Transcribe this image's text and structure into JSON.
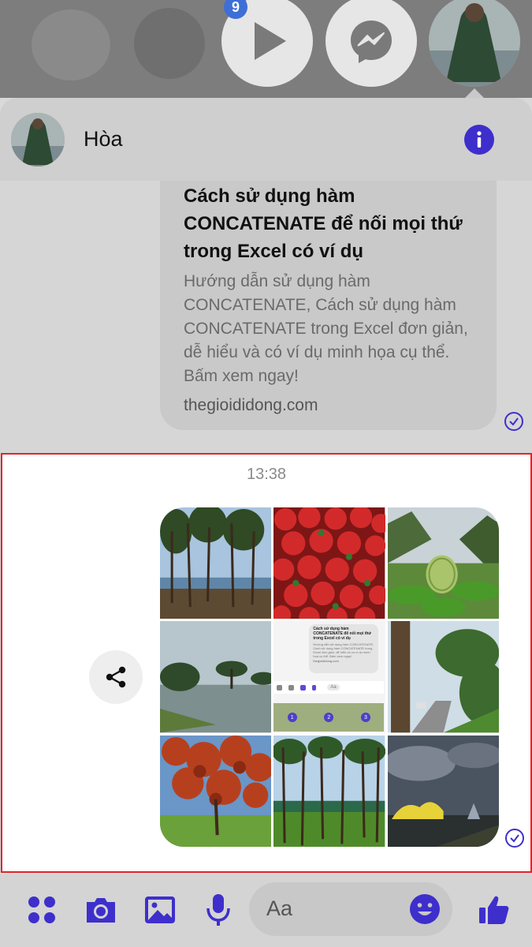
{
  "heads": {
    "badge": "9",
    "items": [
      "video-head",
      "messenger-head",
      "contact-avatar-head"
    ]
  },
  "header": {
    "contact_name": "Hòa",
    "info_icon": "info-icon"
  },
  "link_preview": {
    "title": "Cách sử dụng hàm CONCATENATE để nối mọi thứ trong Excel có ví dụ",
    "description": "Hướng dẫn sử dụng hàm CONCATENATE, Cách sử dụng hàm CONCATENATE trong Excel đơn giản, dễ hiểu và có ví dụ minh họa cụ thể. Bấm xem ngay!",
    "domain": "thegioididong.com"
  },
  "message": {
    "timestamp": "13:38",
    "photos": [
      "pine-forest-lake",
      "strawberries",
      "custard-apple-plant",
      "lake-with-pine-trees",
      "chat-screenshot",
      "roadside-forest",
      "red-flowering-tree",
      "pine-forest",
      "night-building"
    ],
    "thumbnail": {
      "title": "Cách sử dụng hàm CONCATENATE để nối mọi thứ trong Excel có ví dụ",
      "description": "Hướng dẫn sử dụng hàm CONCATENATE, Cách sử dụng hàm CONCATENATE trong Excel đơn giản, dễ hiểu và có ví dụ minh họa cụ thể. Bấm xem ngay!",
      "domain": "thegioididong.com",
      "placeholder": "Aa",
      "numbers": [
        "1",
        "2",
        "3"
      ]
    }
  },
  "composer": {
    "placeholder": "Aa"
  },
  "colors": {
    "accent": "#3e2fcc",
    "highlight_border": "#e0242a"
  }
}
